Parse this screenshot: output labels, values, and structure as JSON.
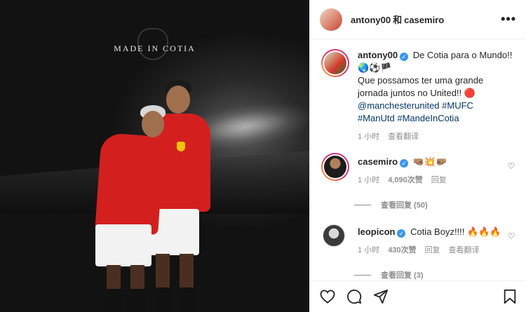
{
  "media": {
    "title": "MADE IN COTIA"
  },
  "header": {
    "user1": "antony00",
    "separator": "和",
    "user2": "casemiro",
    "more": "•••"
  },
  "caption": {
    "username": "antony00",
    "line1": "De Cotia para o Mundo!! 🌏⚽🏴",
    "line2": "Que possamos ter uma grande jornada juntos no United!! 🔴",
    "mention": "@manchesterunited",
    "tag1": "#MUFC",
    "tag2": "#ManUtd",
    "tag3": "#MandeInCotia",
    "time": "1 小时",
    "translate": "查看翻译"
  },
  "comments": [
    {
      "username": "casemiro",
      "text": "🤜🏽💥🤛🏽",
      "time": "1 小时",
      "likes": "4,090次赞",
      "reply": "回复",
      "view_replies": "查看回复 (50)"
    },
    {
      "username": "leopicon",
      "text": "Cotia Boyz!!!! 🔥🔥🔥",
      "time": "1 小时",
      "likes": "430次赞",
      "reply": "回复",
      "translate": "查看翻译",
      "view_replies": "查看回复 (3)"
    }
  ],
  "icons": {
    "like": "heart-icon",
    "comment": "comment-icon",
    "share": "share-icon",
    "save": "bookmark-icon"
  },
  "colors": {
    "verified": "#3897f0",
    "tag": "#00376b",
    "meta": "#8e8e8e"
  }
}
